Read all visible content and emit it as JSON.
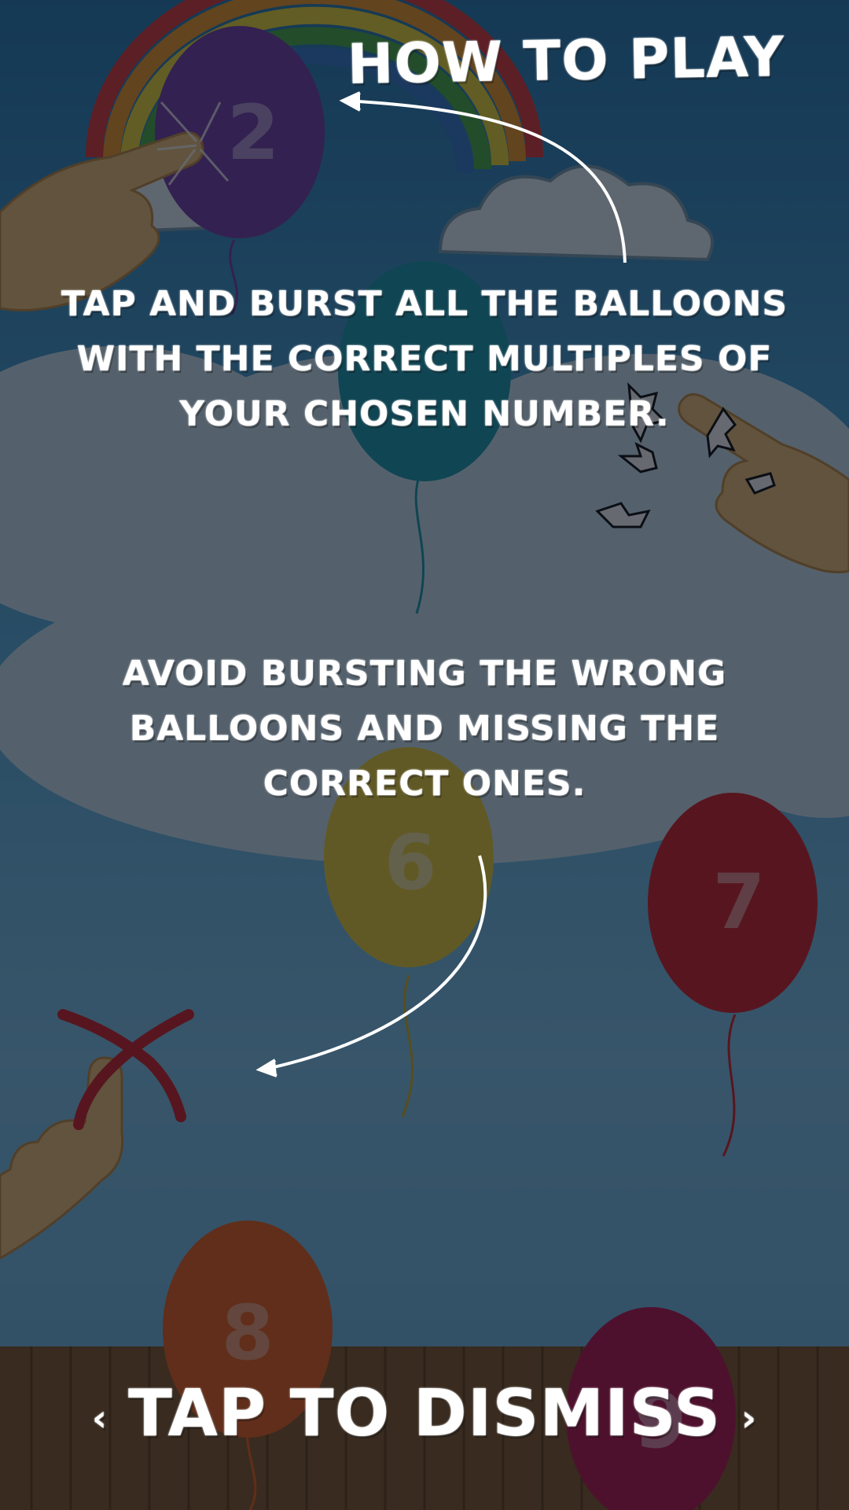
{
  "screen": {
    "title": "HOW TO PLAY",
    "instructions": [
      "TAP AND BURST ALL THE BALLOONS WITH THE CORRECT MULTIPLES OF YOUR CHOSEN NUMBER.",
      "AVOID BURSTING THE WRONG BALLOONS AND MISSING THE CORRECT ONES."
    ],
    "dismiss": {
      "label": "TAP TO DISMISS",
      "left_chevron": "‹",
      "right_chevron": "›"
    }
  },
  "balloons": [
    {
      "number": "2",
      "color": "#7a3fae"
    },
    {
      "number": "",
      "color": "#1f9db2"
    },
    {
      "number": "6",
      "color": "#f1d33a"
    },
    {
      "number": "7",
      "color": "#d8232a"
    },
    {
      "number": "8",
      "color": "#f0621e"
    },
    {
      "number": "9",
      "color": "#c0154f"
    }
  ],
  "icons": [
    "pointing-hand-icon",
    "burst-icon",
    "cross-mark-icon",
    "curved-arrow-icon",
    "rainbow-icon",
    "cloud-icon"
  ]
}
